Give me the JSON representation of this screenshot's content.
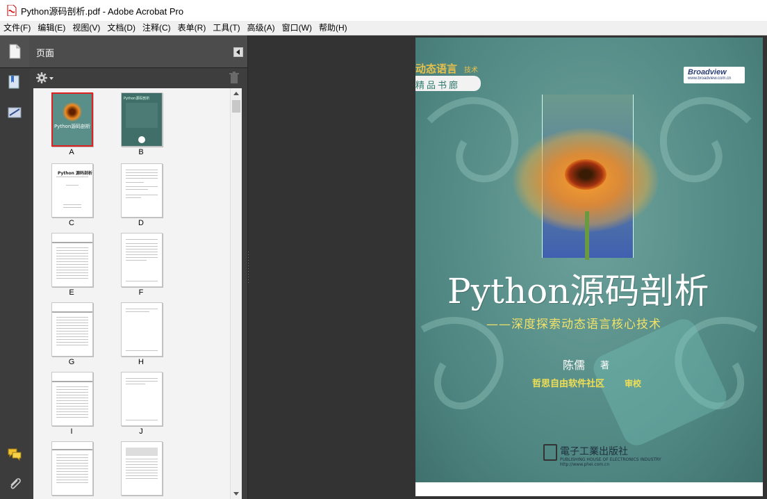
{
  "window": {
    "title": "Python源码剖析.pdf - Adobe Acrobat Pro"
  },
  "menu": [
    {
      "label": "文件(F)"
    },
    {
      "label": "编辑(E)"
    },
    {
      "label": "视图(V)"
    },
    {
      "label": "文档(D)"
    },
    {
      "label": "注释(C)"
    },
    {
      "label": "表单(R)"
    },
    {
      "label": "工具(T)"
    },
    {
      "label": "高级(A)"
    },
    {
      "label": "窗口(W)"
    },
    {
      "label": "帮助(H)"
    }
  ],
  "nav_panel": {
    "title": "页面",
    "thumbnails": [
      {
        "label": "A",
        "selected": true
      },
      {
        "label": "B",
        "selected": false
      },
      {
        "label": "C",
        "selected": false
      },
      {
        "label": "D",
        "selected": false
      },
      {
        "label": "E",
        "selected": false
      },
      {
        "label": "F",
        "selected": false
      },
      {
        "label": "G",
        "selected": false
      },
      {
        "label": "H",
        "selected": false
      },
      {
        "label": "I",
        "selected": false
      },
      {
        "label": "J",
        "selected": false
      }
    ]
  },
  "thumb_texts": {
    "cover_title": "Python源码剖析",
    "title_page_title": "Python 源码剖析",
    "back_cover_title": "Python源码剖析"
  },
  "icons": {
    "rail": [
      "pages-icon",
      "bookmarks-icon",
      "signatures-icon",
      "comments-icon",
      "attachments-icon"
    ]
  },
  "cover": {
    "series": "动态语言",
    "series_tag": "技术",
    "series_sub": "精品书廊",
    "brand": "Broadview",
    "brand_url": "www.broadview.com.cn",
    "title": "Python源码剖析",
    "subtitle": "——深度探索动态语言核心技术",
    "author": "陈儒",
    "author_role": "著",
    "reviewer": "哲思自由软件社区",
    "reviewer_role": "审校",
    "publisher": "電子工業出版社",
    "publisher_en": "PUBLISHING HOUSE OF ELECTRONICS INDUSTRY",
    "publisher_url": "http://www.phei.com.cn"
  }
}
